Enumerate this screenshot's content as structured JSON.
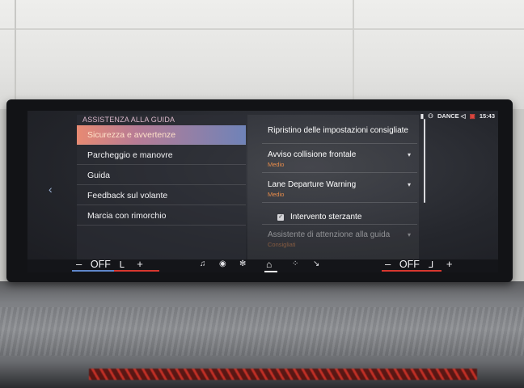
{
  "left_menu": {
    "section_title": "ASSISTENZA ALLA GUIDA",
    "items": [
      {
        "label": "Sicurezza e avvertenze",
        "active": true
      },
      {
        "label": "Parcheggio e manovre",
        "active": false
      },
      {
        "label": "Guida",
        "active": false
      },
      {
        "label": "Feedback sul volante",
        "active": false
      },
      {
        "label": "Marcia con rimorchio",
        "active": false
      }
    ]
  },
  "status_bar": {
    "profile": "DANCE",
    "time": "15:43"
  },
  "options": {
    "reset_label": "Ripristino delle impostazioni consigliate",
    "items": [
      {
        "label": "Avviso collisione frontale",
        "value": "Medio"
      },
      {
        "label": "Lane Departure Warning",
        "value": "Medio"
      }
    ],
    "checkbox_label": "Intervento sterzante",
    "partial_label": "Assistente di attenzione alla guida",
    "partial_value": "Consigliati"
  },
  "climate": {
    "left": {
      "minus": "–",
      "value": "OFF",
      "plus": "+"
    },
    "right": {
      "minus": "–",
      "value": "OFF",
      "plus": "+"
    }
  },
  "colors": {
    "accent_orange": "#e88c4a",
    "active_gradient_start": "#e88a72",
    "active_gradient_end": "#6f83b8",
    "heat_red": "#d7372f",
    "cool_blue": "#5f86c9"
  },
  "icons": [
    "back-arrow-icon",
    "music-icon",
    "navigation-icon",
    "fan-icon",
    "home-icon",
    "apps-icon",
    "phone-icon",
    "seat-heat-icon",
    "steering-heat-icon",
    "battery-icon",
    "profile-icon",
    "notification-icon"
  ]
}
